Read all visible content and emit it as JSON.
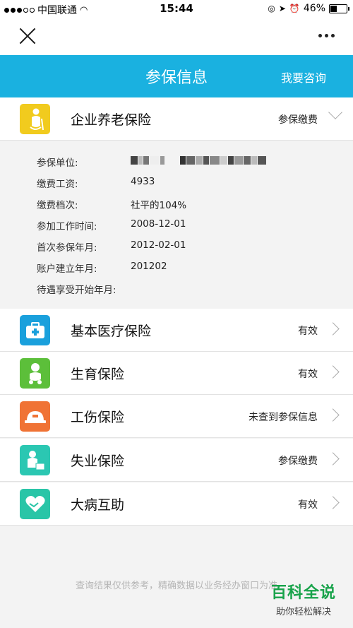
{
  "status_bar": {
    "carrier": "中国联通",
    "time": "15:44",
    "battery": "46%",
    "battery_level": 0.46
  },
  "header": {
    "title": "参保信息",
    "consult_label": "我要咨询"
  },
  "pension": {
    "title": "企业养老保险",
    "status": "参保缴费",
    "details": [
      {
        "label": "参保单位:",
        "value": ""
      },
      {
        "label": "缴费工资:",
        "value": "4933"
      },
      {
        "label": "缴费档次:",
        "value": "社平的104%"
      },
      {
        "label": "参加工作时间:",
        "value": "2008-12-01"
      },
      {
        "label": "首次参保年月:",
        "value": "2012-02-01"
      },
      {
        "label": "账户建立年月:",
        "value": "201202"
      },
      {
        "label": "待遇享受开始年月:",
        "value": ""
      }
    ]
  },
  "insurances": [
    {
      "title": "基本医疗保险",
      "status": "有效",
      "icon": "medical-kit-icon",
      "color": "#1aa0dc"
    },
    {
      "title": "生育保险",
      "status": "有效",
      "icon": "baby-icon",
      "color": "#5cbf3a"
    },
    {
      "title": "工伤保险",
      "status": "未查到参保信息",
      "icon": "helmet-icon",
      "color": "#f07335"
    },
    {
      "title": "失业保险",
      "status": "参保缴费",
      "icon": "worker-icon",
      "color": "#2bc7b2"
    },
    {
      "title": "大病互助",
      "status": "有效",
      "icon": "heart-hands-icon",
      "color": "#29c5a7"
    }
  ],
  "footer": {
    "note": "查询结果仅供参考，精确数据以业务经办窗口为准"
  },
  "watermark": {
    "main": "百科全说",
    "sub": "助你轻松解决"
  }
}
